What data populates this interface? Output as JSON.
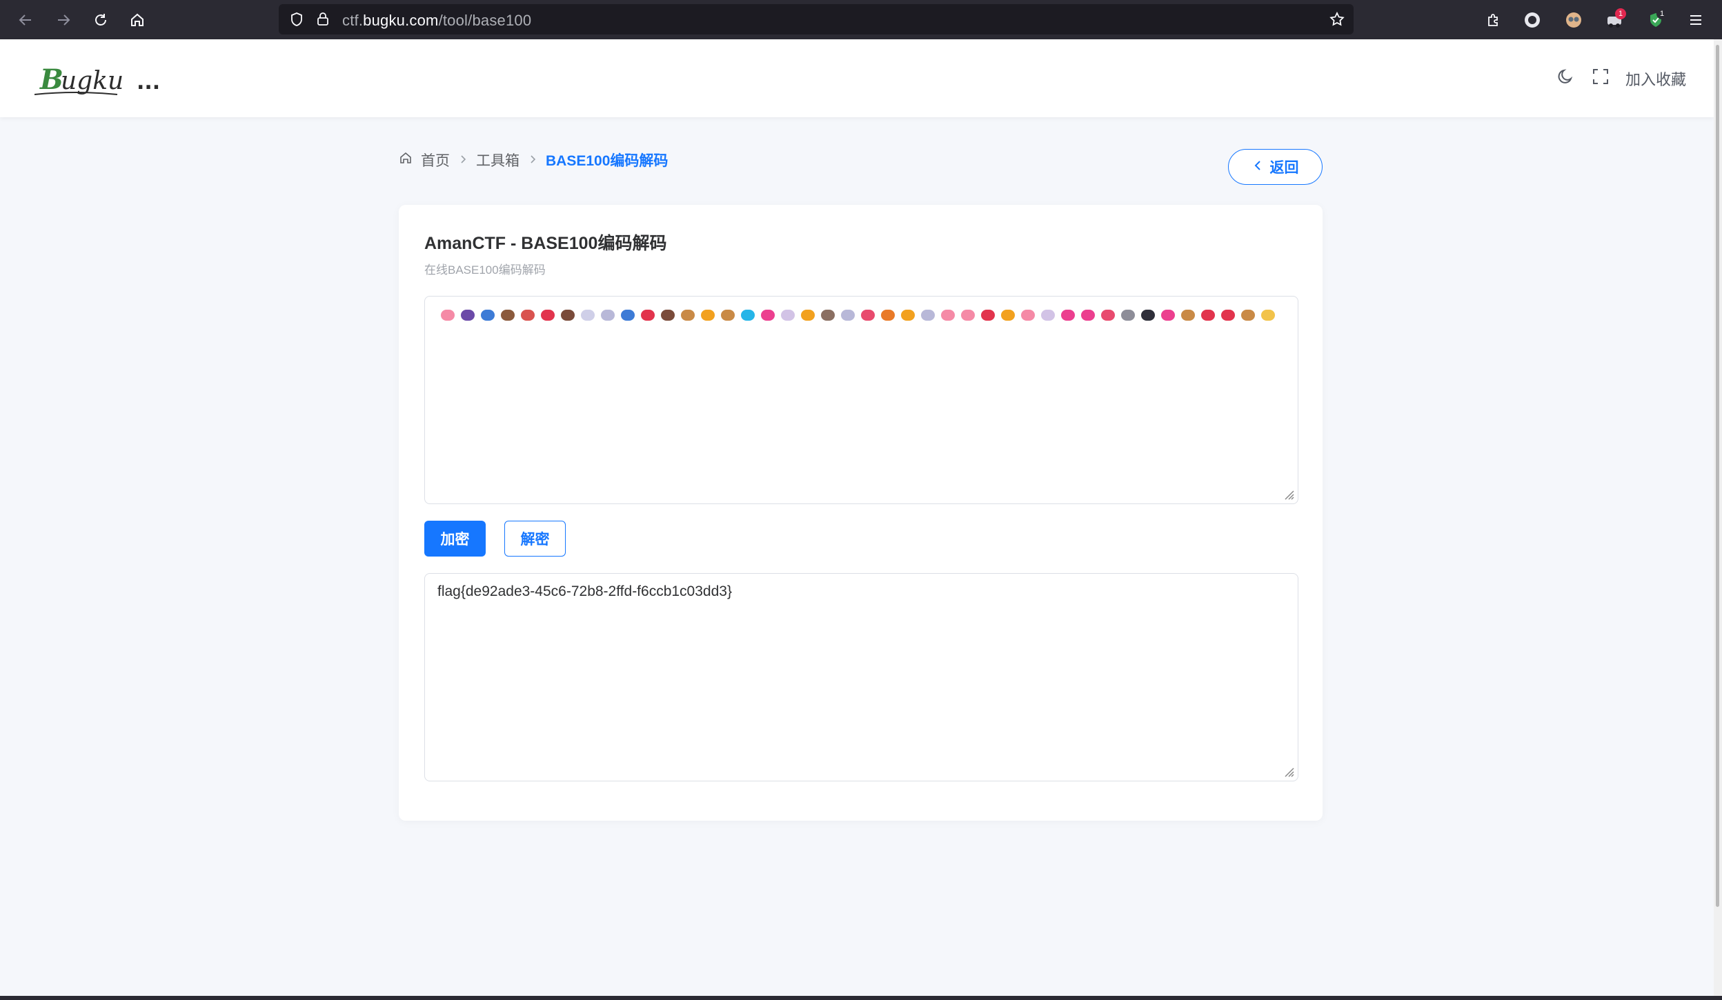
{
  "browser": {
    "url_prefix": "ctf.",
    "url_domain": "bugku.com",
    "url_path": "/tool/base100",
    "ext_badge_red": "1",
    "ext_badge_green": "1"
  },
  "header": {
    "logo_text": "Bugku...",
    "favorite_label": "加入收藏"
  },
  "breadcrumb": {
    "home": "首页",
    "toolbox": "工具箱",
    "current": "BASE100编码解码"
  },
  "back_button": "返回",
  "card": {
    "title": "AmanCTF - BASE100编码解码",
    "subtitle": "在线BASE100编码解码"
  },
  "input_emojis": [
    "#f58aa6",
    "#6b4aa8",
    "#3d7bd6",
    "#8b5a3c",
    "#d9534f",
    "#e2344d",
    "#7a4b3a",
    "#cfcfe8",
    "#b8b8d8",
    "#3d7bd6",
    "#e2344d",
    "#7a4b3a",
    "#c98a46",
    "#f2a11f",
    "#c98a46",
    "#26b5e8",
    "#ec3f8f",
    "#d2c3e6",
    "#f2a11f",
    "#8a6f62",
    "#b8b8d8",
    "#e84b6e",
    "#e97a28",
    "#f2a11f",
    "#b8b8d8",
    "#f58aa6",
    "#f58aa6",
    "#e2344d",
    "#f2a11f",
    "#f58aa6",
    "#d2c3e6",
    "#ec3f8f",
    "#ec3f8f",
    "#e84b6e",
    "#8d8d98",
    "#2f2f3a",
    "#ec3f8f",
    "#c98a46",
    "#e2344d",
    "#e2344d",
    "#c98a46",
    "#f2c34a"
  ],
  "buttons": {
    "encrypt": "加密",
    "decrypt": "解密"
  },
  "output_text": "flag{de92ade3-45c6-72b8-2ffd-f6ccb1c03dd3}",
  "colors": {
    "accent": "#1677ff",
    "chrome_bg": "#2b2a33",
    "page_bg": "#f5f7fb"
  }
}
